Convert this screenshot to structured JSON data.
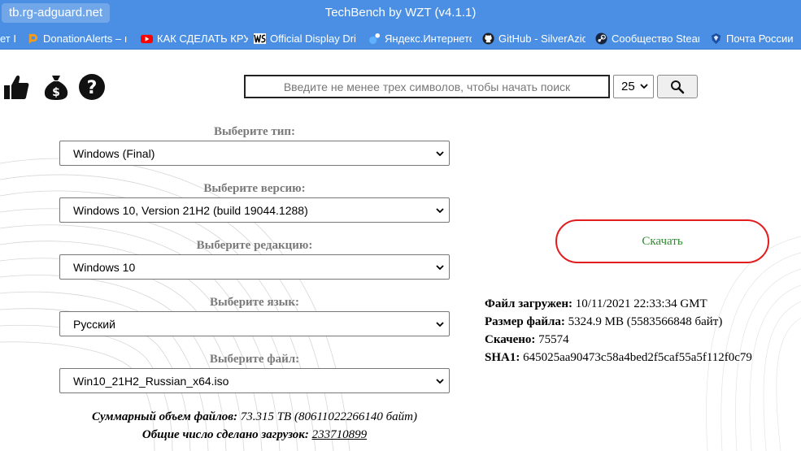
{
  "browser": {
    "url": "tb.rg-adguard.net",
    "title": "TechBench by WZT (v4.1.1)",
    "bookmarks": [
      {
        "label": "ет I",
        "icon": "bookmark-icon"
      },
      {
        "label": "DonationAlerts – ı",
        "icon": "donationalerts-icon",
        "color": "#f59c1a"
      },
      {
        "label": "КАК СДЕЛАТЬ КРУ",
        "icon": "youtube-icon",
        "color": "#ff0000"
      },
      {
        "label": "Official Display Dri",
        "icon": "ws-icon"
      },
      {
        "label": "Яндекс.Интернетс",
        "icon": "yandex-internetometer-icon"
      },
      {
        "label": "GitHub - SilverAzic",
        "icon": "github-icon"
      },
      {
        "label": "Сообщество Stear",
        "icon": "steam-icon"
      },
      {
        "label": "Почта России",
        "icon": "russian-post-icon"
      }
    ]
  },
  "toolbar": {
    "icons": [
      "thumbs-up-icon",
      "money-bag-icon",
      "question-icon"
    ],
    "search_placeholder": "Введите не менее трех символов, чтобы начать поиск",
    "page_size": "25",
    "search_button_icon": "search-icon"
  },
  "selectors": [
    {
      "label": "Выберите тип:",
      "value": "Windows (Final)"
    },
    {
      "label": "Выберите версию:",
      "value": "Windows 10, Version 21H2 (build 19044.1288)"
    },
    {
      "label": "Выберите редакцию:",
      "value": "Windows 10"
    },
    {
      "label": "Выберите язык:",
      "value": "Русский"
    },
    {
      "label": "Выберите файл:",
      "value": "Win10_21H2_Russian_x64.iso"
    }
  ],
  "stats": {
    "total_size_label": "Суммарный объем файлов:",
    "total_size_value": "73.315 TB (80611022266140 байт)",
    "downloads_label": "Общие число сделано загрузок:",
    "downloads_value": "233710899"
  },
  "download": {
    "button_label": "Скачать",
    "accent": "#e11d1d",
    "text_color": "#2e8b2e"
  },
  "file_info": {
    "uploaded_label": "Файл загружен:",
    "uploaded_value": "10/11/2021 22:33:34 GMT",
    "size_label": "Размер файла:",
    "size_value": "5324.9 MB (5583566848 байт)",
    "downloaded_label": "Скачено:",
    "downloaded_value": "75574",
    "sha1_label": "SHA1:",
    "sha1_value": "645025aa90473c58a4bed2f5caf55a5f112f0c79"
  }
}
